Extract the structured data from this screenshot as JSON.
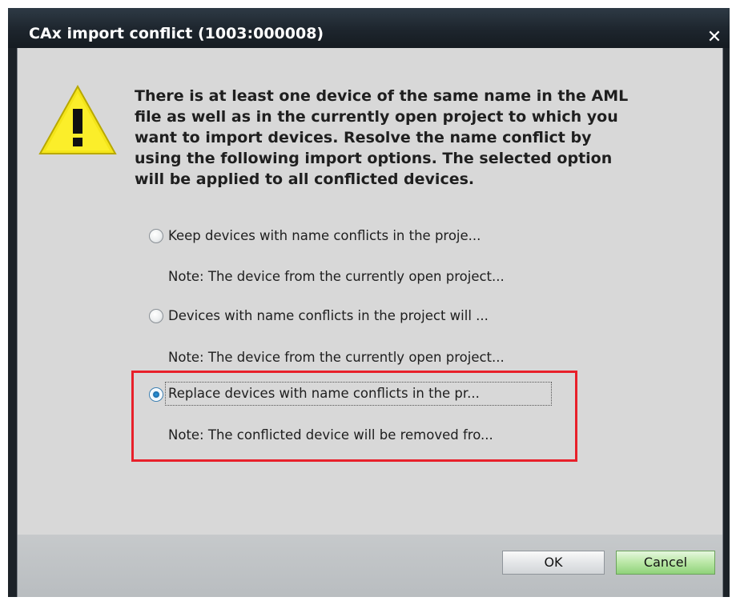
{
  "dialog": {
    "title": "CAx import conflict (1003:000008)",
    "close_symbol": "✕",
    "icon": "warning-icon"
  },
  "message": {
    "lines": [
      "There is at least one device of the same name in the AML",
      "file as well as in the currently open project to which you",
      "want to import  devices. Resolve the name conflict by",
      "using the following import options. The selected option",
      "will be applied to all conflicted devices."
    ]
  },
  "options": [
    {
      "label": "Keep devices with name conflicts in the proje...",
      "note": "Note: The device from the currently open project...",
      "selected": false
    },
    {
      "label": "Devices with name conflicts in the project will ...",
      "note": "Note: The device from the currently open project...",
      "selected": false
    },
    {
      "label": "Replace devices with name conflicts in the pr...",
      "note": "Note: The conflicted device will be removed fro...",
      "selected": true
    }
  ],
  "buttons": {
    "ok": "OK",
    "cancel": "Cancel"
  },
  "colors": {
    "highlight_frame": "#e8202a",
    "title_bar": "#1d252d",
    "client_bg": "#d8d8d8",
    "cancel_green": "#b9e7a6"
  }
}
